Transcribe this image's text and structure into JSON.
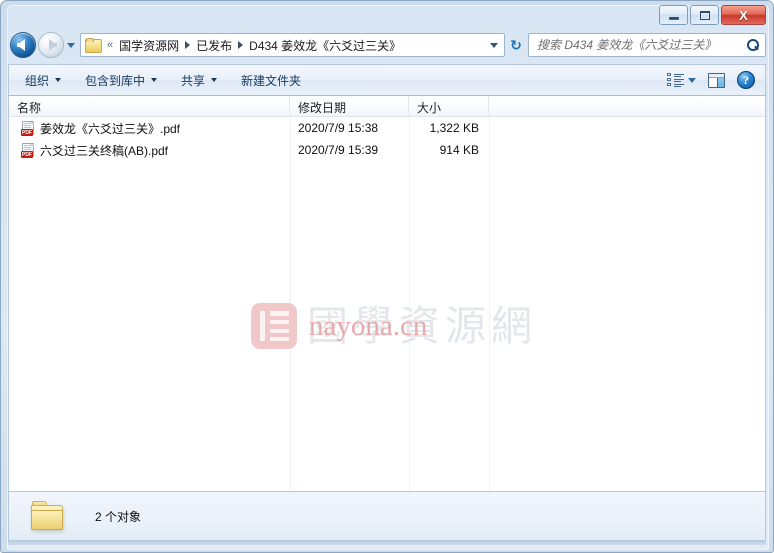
{
  "window": {
    "controls": {
      "minimize_label": "Minimize",
      "maximize_label": "Maximize",
      "close_label": "X"
    }
  },
  "navigation": {
    "back_label": "后退",
    "forward_label": "前进",
    "history_label": "最近浏览的位置",
    "refresh_label": "刷新",
    "refresh_glyph": "↻",
    "breadcrumb": {
      "overflow": "«",
      "items": [
        {
          "label": "国学资源网"
        },
        {
          "label": "已发布"
        },
        {
          "label": "D434 姜效龙《六爻过三关》"
        }
      ]
    }
  },
  "search": {
    "placeholder": "搜索 D434 姜效龙《六爻过三关》",
    "value": ""
  },
  "toolbar": {
    "items": [
      {
        "label": "组织",
        "has_menu": true
      },
      {
        "label": "包含到库中",
        "has_menu": true
      },
      {
        "label": "共享",
        "has_menu": true
      },
      {
        "label": "新建文件夹",
        "has_menu": false
      }
    ],
    "view_button_label": "更改您的视图",
    "preview_button_label": "显示预览窗格",
    "help_button_label": "?"
  },
  "file_list": {
    "columns": [
      {
        "label": "名称"
      },
      {
        "label": "修改日期"
      },
      {
        "label": "大小"
      },
      {
        "label": ""
      }
    ],
    "rows": [
      {
        "icon": "pdf-file-icon",
        "badge": "PDF",
        "name": "姜效龙《六爻过三关》.pdf",
        "date": "2020/7/9 15:38",
        "size": "1,322 KB"
      },
      {
        "icon": "pdf-file-icon",
        "badge": "PDF",
        "name": "六爻过三关终稿(AB).pdf",
        "date": "2020/7/9 15:39",
        "size": "914 KB"
      }
    ]
  },
  "watermark": {
    "site_name": "國學資源網",
    "url": "nayona.cn",
    "logo_color": "#f0c6c8",
    "text_color": "#e3e6ea",
    "url_color": "#e8a9ad"
  },
  "status_bar": {
    "item_count_text": "2 个对象",
    "folder_icon": "folder-icon"
  },
  "colors": {
    "frame": "#cfdceb",
    "toolbar_text": "#15385c",
    "close_button": "#c9392c",
    "accent": "#1d6fb8"
  }
}
